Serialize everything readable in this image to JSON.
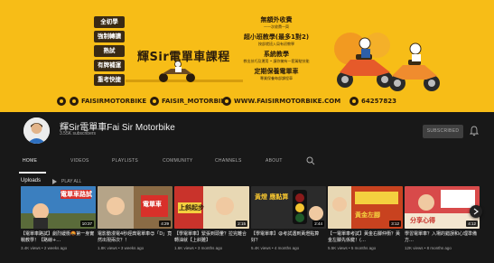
{
  "banner": {
    "title": "輝Sir電單車課程",
    "tags": [
      "全初學",
      "強制轉讀",
      "熟試",
      "有牌補運",
      "重考快捷"
    ],
    "features": [
      {
        "title": "無額外收費",
        "subtitle": "一一次收費一齊"
      },
      {
        "title": "超小班教學(最多1對2)",
        "subtitle": "按部就班入局有初教學"
      },
      {
        "title": "系統教學",
        "subtitle": "教出技巧及運用 • 讓你擁有一套駕駛技能"
      },
      {
        "title": "定期保養電單車",
        "subtitle": "專業保養每部課程車"
      }
    ],
    "contacts": [
      {
        "icon": "youtube-icon",
        "label": "FAISIRMOTORBIKE"
      },
      {
        "icon": "instagram-icon",
        "label": "FAISIR_MOTORBIKE"
      },
      {
        "icon": "globe-icon",
        "label": "WWW.FAISIRMOTORBIKE.COM"
      },
      {
        "icon": "whatsapp-icon",
        "label": "64257823"
      }
    ],
    "colors": {
      "background": "#f7bd17",
      "text": "#2a1c0c"
    }
  },
  "channel": {
    "name": "輝Sir電單車Fai Sir Motorbike",
    "subscribers": "3.55K subscribers",
    "subscribe_label": "SUBSCRIBED",
    "tabs": [
      "HOME",
      "VIDEOS",
      "PLAYLISTS",
      "COMMUNITY",
      "CHANNELS",
      "ABOUT"
    ],
    "active_tab": "HOME"
  },
  "uploads": {
    "title": "Uploads",
    "play_all_label": "PLAY ALL",
    "videos": [
      {
        "thumb_text": "電單車路試",
        "duration": "10:37",
        "title": "【電單車路試】劇烈緩衝🤬第一身實戰教學！【路線+…",
        "meta": "3.4K views • 2 weeks ago",
        "bg": "#3b7fbf"
      },
      {
        "thumb_text": "電單車",
        "duration": "4:29",
        "title": "電影動漫電4秒經典電單車😍「D」竟然出現兩次？！",
        "meta": "1.8K views • 3 weeks ago",
        "bg": "#8a6b45"
      },
      {
        "thumb_text": "上斜起步",
        "duration": "2:15",
        "title": "【學電單車】緊張到頭暈？拉完離合轉油就【上斜難】",
        "meta": "1.6K views • 3 months ago",
        "bg": "#c9332b"
      },
      {
        "thumb_text": "黃燈 應點算",
        "duration": "2:44",
        "title": "【學電單車】😩考試遇到黃燈點算好？",
        "meta": "5.4K views • 4 months ago",
        "bg": "#2b2b2b"
      },
      {
        "thumb_text": "黃金左腳",
        "duration": "3:12",
        "title": "【一電單車考試】黃金右腳仲衝？黃金左腳先係鍵！(…",
        "meta": "5.5K views • 5 months ago",
        "bg": "#c8421f"
      },
      {
        "thumb_text": "分享心得",
        "duration": "4:12",
        "title": "學習電單車？入場的錯誤和心理準備方…",
        "meta": "12K views • 8 months ago",
        "bg": "#d84a4a"
      }
    ]
  }
}
